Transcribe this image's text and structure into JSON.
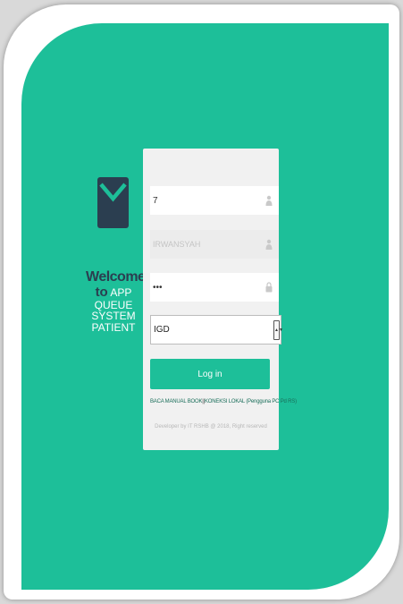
{
  "welcome": {
    "line1": "Welcome",
    "to": "to",
    "app": "APP",
    "queue": "QUEUE",
    "system": "SYSTEM",
    "patient": "PATIENT"
  },
  "form": {
    "user_id": {
      "value": "7",
      "icon": "user-icon"
    },
    "user_name": {
      "value": "IRWANSYAH",
      "icon": "user-icon"
    },
    "password": {
      "value": "•••",
      "icon": "lock-icon"
    },
    "unit_select": {
      "value": "IGD"
    },
    "login_label": "Log in"
  },
  "links": {
    "manual": "BACA MANUAL BOOK",
    "separator": "||",
    "local": "KONEKSI LOKAL (Pengguna PC Pd RS)"
  },
  "footer": "Developer by IT RSHB @ 2018, Right reserved",
  "colors": {
    "accent": "#1dbf99",
    "dark": "#2b3e50"
  }
}
